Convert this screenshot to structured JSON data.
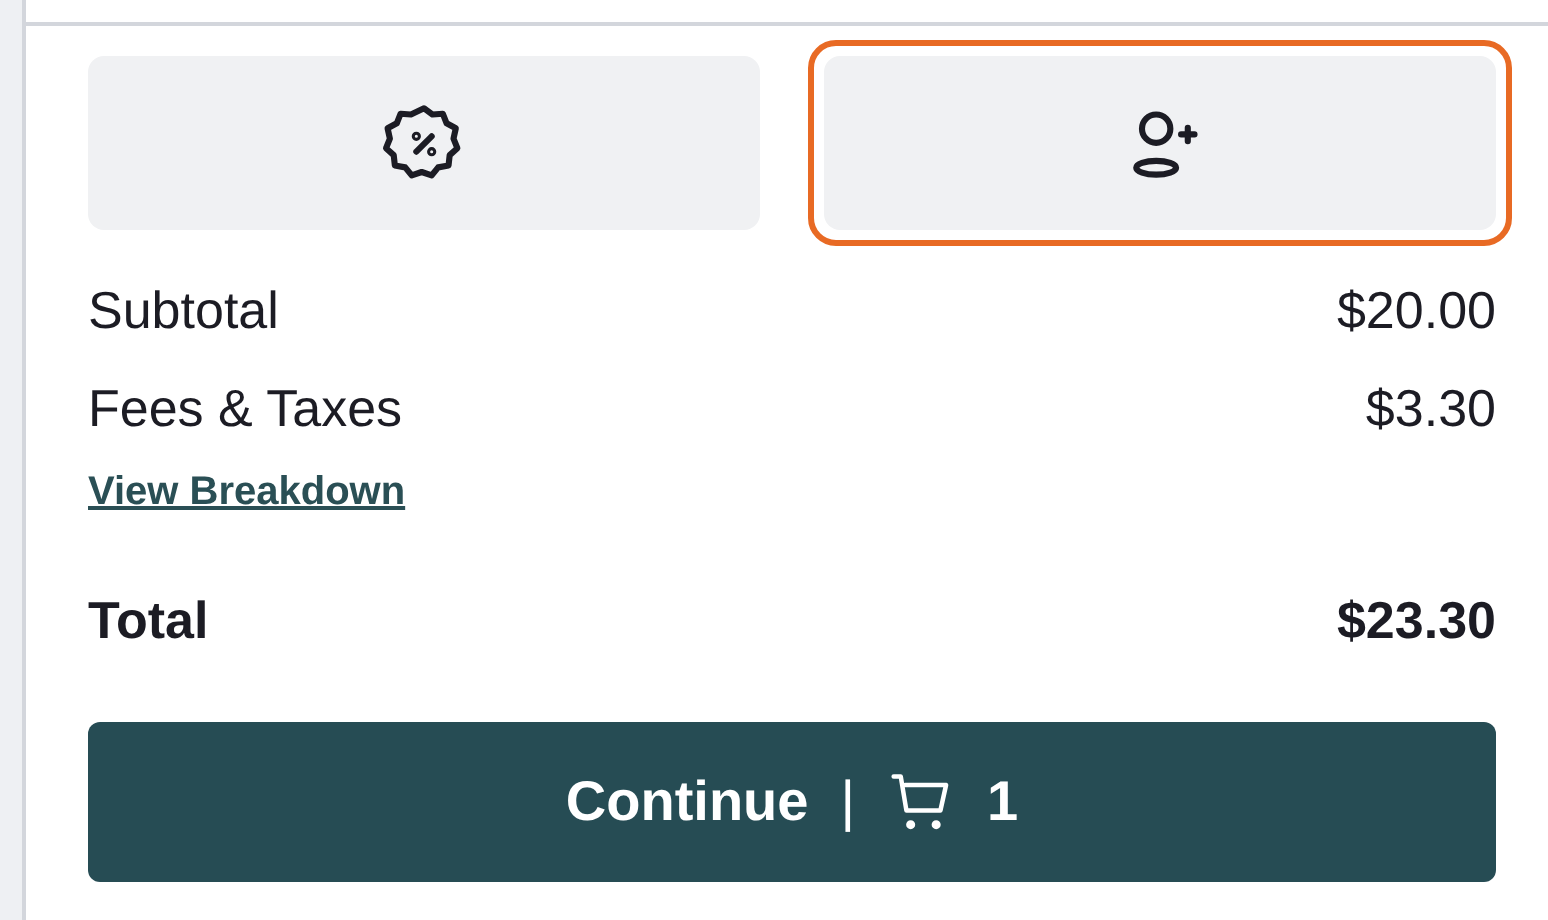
{
  "actions": [
    {
      "kind": "discount",
      "selected": false
    },
    {
      "kind": "add-guest",
      "selected": true
    }
  ],
  "summary": [
    {
      "label": "Subtotal",
      "value": "$20.00"
    },
    {
      "label": "Fees & Taxes",
      "value": "$3.30"
    }
  ],
  "breakdown_link": "View Breakdown",
  "total": {
    "label": "Total",
    "value": "$23.30"
  },
  "continue_button": {
    "label": "Continue",
    "separator": "|",
    "cart_count": "1"
  }
}
